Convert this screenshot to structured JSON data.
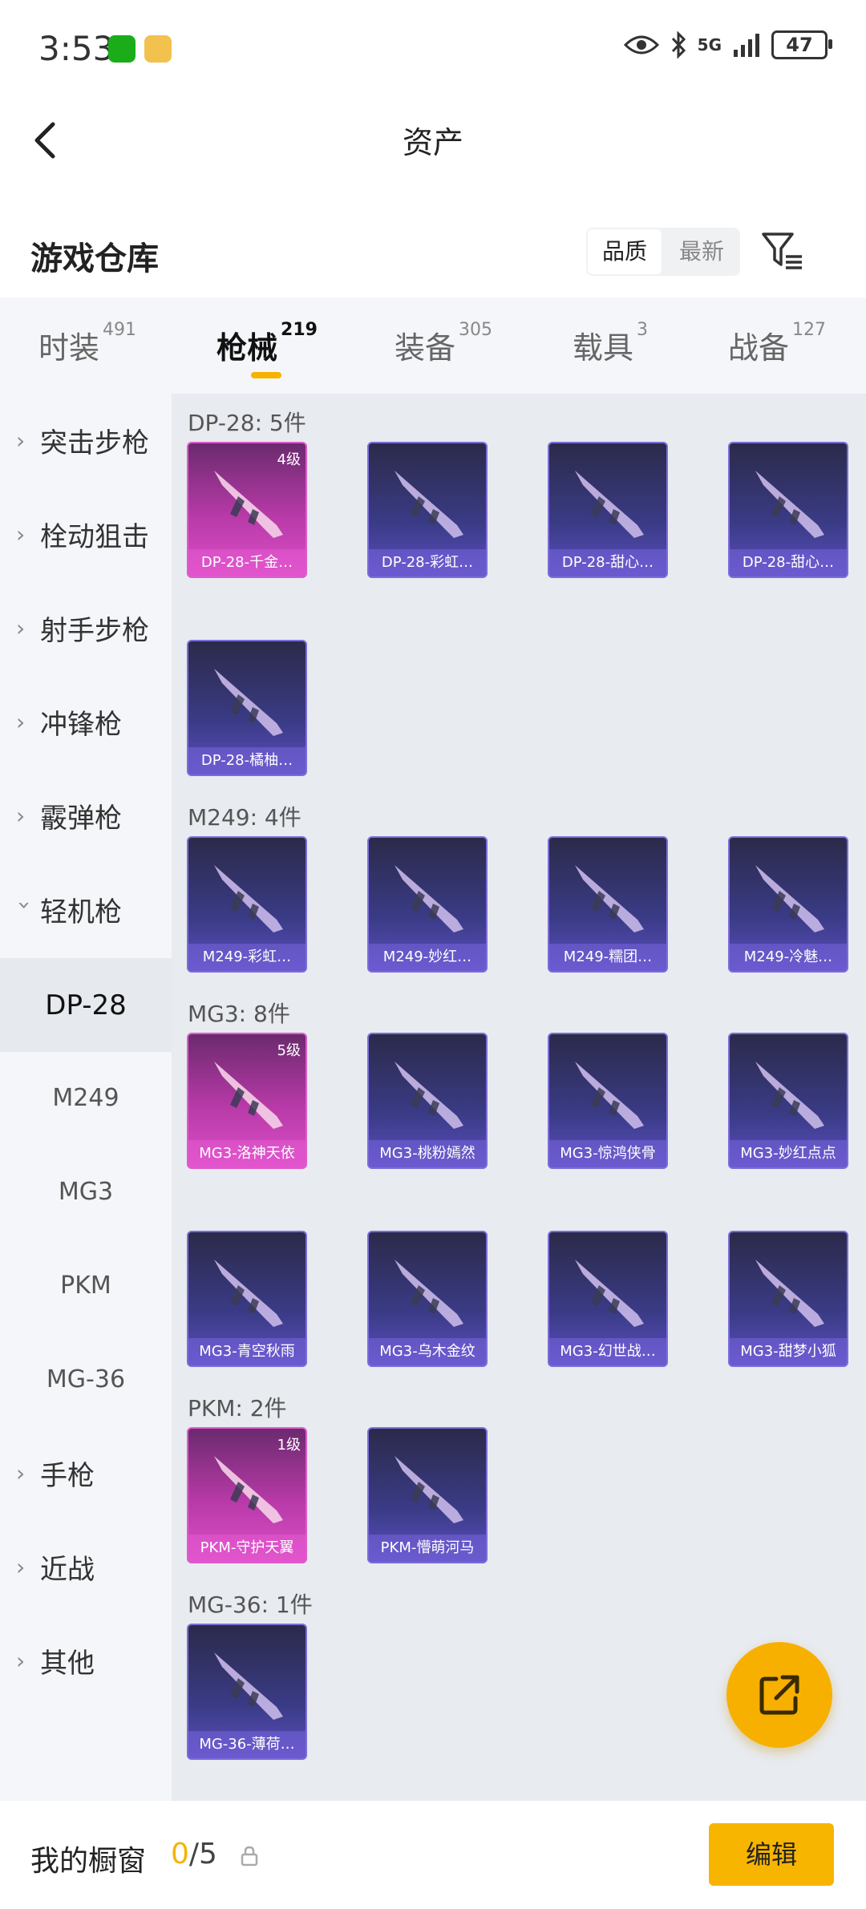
{
  "status_bar": {
    "time": "3:53",
    "network": "5G",
    "battery": "47"
  },
  "nav": {
    "title": "资产"
  },
  "warehouse": {
    "title": "游戏仓库",
    "sort_options": [
      "品质",
      "最新"
    ],
    "active_sort": "品质"
  },
  "tabs": [
    {
      "label": "时装",
      "count": "491"
    },
    {
      "label": "枪械",
      "count": "219",
      "active": true
    },
    {
      "label": "装备",
      "count": "305"
    },
    {
      "label": "载具",
      "count": "3"
    },
    {
      "label": "战备",
      "count": "127"
    }
  ],
  "sidebar": {
    "categories": [
      "突击步枪",
      "栓动狙击",
      "射手步枪",
      "冲锋枪",
      "霰弹枪",
      "轻机枪"
    ],
    "subitems": [
      "DP-28",
      "M249",
      "MG3",
      "PKM",
      "MG-36"
    ],
    "active_subitem": "DP-28",
    "more_categories": [
      "手枪",
      "近战",
      "其他"
    ]
  },
  "groups": [
    {
      "title": "DP-28: 5件",
      "items": [
        {
          "name": "DP-28-千金…",
          "level": "4级",
          "style": "pink"
        },
        {
          "name": "DP-28-彩虹…",
          "style": "purple"
        },
        {
          "name": "DP-28-甜心…",
          "style": "purple"
        },
        {
          "name": "DP-28-甜心…",
          "style": "purple"
        },
        {
          "name": "DP-28-橘柚…",
          "style": "purple"
        }
      ]
    },
    {
      "title": "M249: 4件",
      "items": [
        {
          "name": "M249-彩虹…",
          "style": "purple"
        },
        {
          "name": "M249-妙红…",
          "style": "purple"
        },
        {
          "name": "M249-糯团…",
          "style": "purple"
        },
        {
          "name": "M249-冷魅…",
          "style": "purple"
        }
      ]
    },
    {
      "title": "MG3: 8件",
      "items": [
        {
          "name": "MG3-洛神天依",
          "level": "5级",
          "style": "pink"
        },
        {
          "name": "MG3-桃粉嫣然",
          "style": "purple"
        },
        {
          "name": "MG3-惊鸿侠骨",
          "style": "purple"
        },
        {
          "name": "MG3-妙红点点",
          "style": "purple"
        },
        {
          "name": "MG3-青空秋雨",
          "style": "purple"
        },
        {
          "name": "MG3-乌木金纹",
          "style": "purple"
        },
        {
          "name": "MG3-幻世战…",
          "style": "purple"
        },
        {
          "name": "MG3-甜梦小狐",
          "style": "purple"
        }
      ]
    },
    {
      "title": "PKM: 2件",
      "items": [
        {
          "name": "PKM-守护天翼",
          "level": "1级",
          "style": "pink"
        },
        {
          "name": "PKM-懵萌河马",
          "style": "purple"
        }
      ]
    },
    {
      "title": "MG-36: 1件",
      "items": [
        {
          "name": "MG-36-薄荷…",
          "style": "purple"
        }
      ]
    }
  ],
  "showcase": {
    "label": "我的橱窗",
    "current": "0",
    "total": "/5"
  },
  "edit_button": "编辑",
  "colors": {
    "accent": "#f5b300",
    "card_purple": "#4b47a8",
    "card_pink": "#d04ac0"
  }
}
